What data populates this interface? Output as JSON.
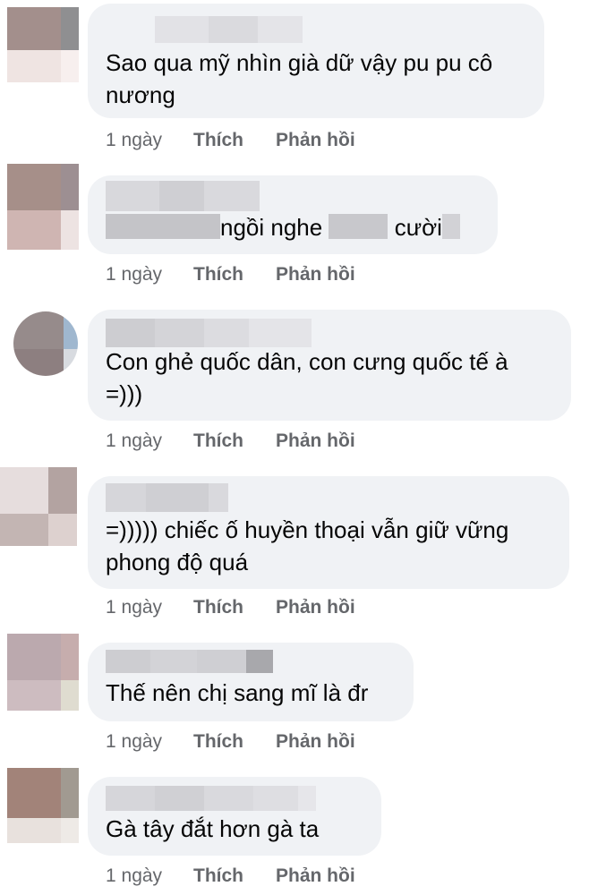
{
  "comments": [
    {
      "text": "Sao qua mỹ nhìn già dữ vậy pu pu cô\nnương",
      "time": "1 ngày",
      "like": "Thích",
      "reply": "Phản hồi"
    },
    {
      "text_a": "ngồi nghe",
      "text_b": "cười",
      "time": "1 ngày",
      "like": "Thích",
      "reply": "Phản hồi"
    },
    {
      "text": "Con ghẻ quốc dân, con cưng quốc tế à\n=)))",
      "time": "1 ngày",
      "like": "Thích",
      "reply": "Phản hồi"
    },
    {
      "text": "=))))) chiếc ố huyền thoại vẫn giữ vững\nphong độ quá",
      "time": "1 ngày",
      "like": "Thích",
      "reply": "Phản hồi"
    },
    {
      "text": "Thế nên chị sang mĩ là đr",
      "time": "1 ngày",
      "like": "Thích",
      "reply": "Phản hồi"
    },
    {
      "text": "Gà tây đắt hơn gà ta",
      "time": "1 ngày",
      "like": "Thích",
      "reply": "Phản hồi"
    }
  ],
  "colors": {
    "bubble": "#f0f2f5",
    "meta": "#65676b",
    "text": "#050505"
  }
}
